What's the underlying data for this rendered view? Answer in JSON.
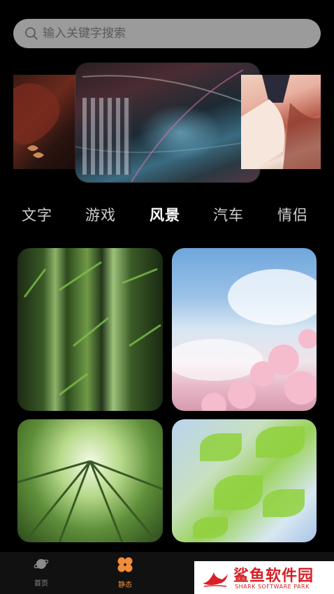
{
  "search": {
    "placeholder": "输入关键字搜索"
  },
  "categories": [
    {
      "label": "文字"
    },
    {
      "label": "游戏"
    },
    {
      "label": "风景",
      "active": true
    },
    {
      "label": "汽车"
    },
    {
      "label": "情侣"
    }
  ],
  "tabs": [
    {
      "label": "首页",
      "icon": "planet-icon"
    },
    {
      "label": "静态",
      "icon": "four-petal-icon",
      "active": true
    }
  ],
  "watermark": {
    "name": "鲨鱼软件园",
    "subtitle": "SHARK SOFTWARE PARK"
  },
  "colors": {
    "accent": "#f28c38",
    "watermark": "#d81f26",
    "background": "#000000"
  }
}
